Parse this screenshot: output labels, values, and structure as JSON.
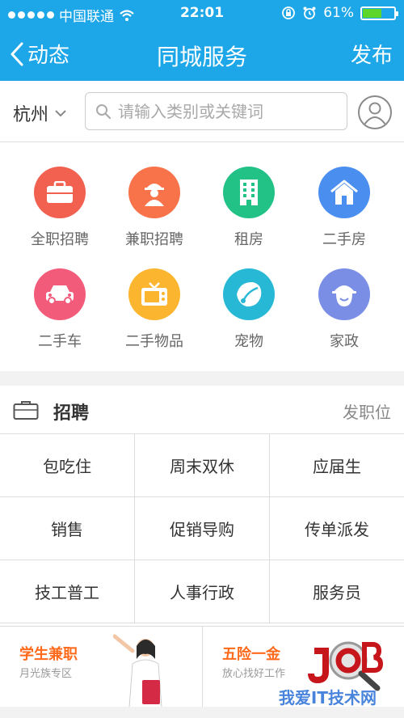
{
  "status": {
    "carrier": "中国联通",
    "time": "22:01",
    "battery": "61%",
    "battery_level": 0.61
  },
  "nav": {
    "back_label": "动态",
    "title": "同城服务",
    "publish_label": "发布"
  },
  "search": {
    "city": "杭州",
    "placeholder": "请输入类别或关键词"
  },
  "categories": [
    {
      "label": "全职招聘",
      "icon": "briefcase-icon",
      "color": "#f2604f"
    },
    {
      "label": "兼职招聘",
      "icon": "worker-icon",
      "color": "#f8734a"
    },
    {
      "label": "租房",
      "icon": "building-icon",
      "color": "#22c287"
    },
    {
      "label": "二手房",
      "icon": "house-icon",
      "color": "#4a8ef0"
    },
    {
      "label": "二手车",
      "icon": "car-icon",
      "color": "#f35b7a"
    },
    {
      "label": "二手物品",
      "icon": "tv-icon",
      "color": "#fbb52e"
    },
    {
      "label": "宠物",
      "icon": "pet-icon",
      "color": "#27b8d6"
    },
    {
      "label": "家政",
      "icon": "housekeeping-icon",
      "color": "#7b8ee6"
    }
  ],
  "jobs": {
    "title": "招聘",
    "action": "发职位",
    "tags": [
      "包吃住",
      "周末双休",
      "应届生",
      "销售",
      "促销导购",
      "传单派发",
      "技工普工",
      "人事行政",
      "服务员"
    ]
  },
  "banners": [
    {
      "title": "学生兼职",
      "subtitle": "月光族专区"
    },
    {
      "title": "五险一金",
      "subtitle": "放心找好工作"
    }
  ],
  "watermark": "我爱IT技术网"
}
